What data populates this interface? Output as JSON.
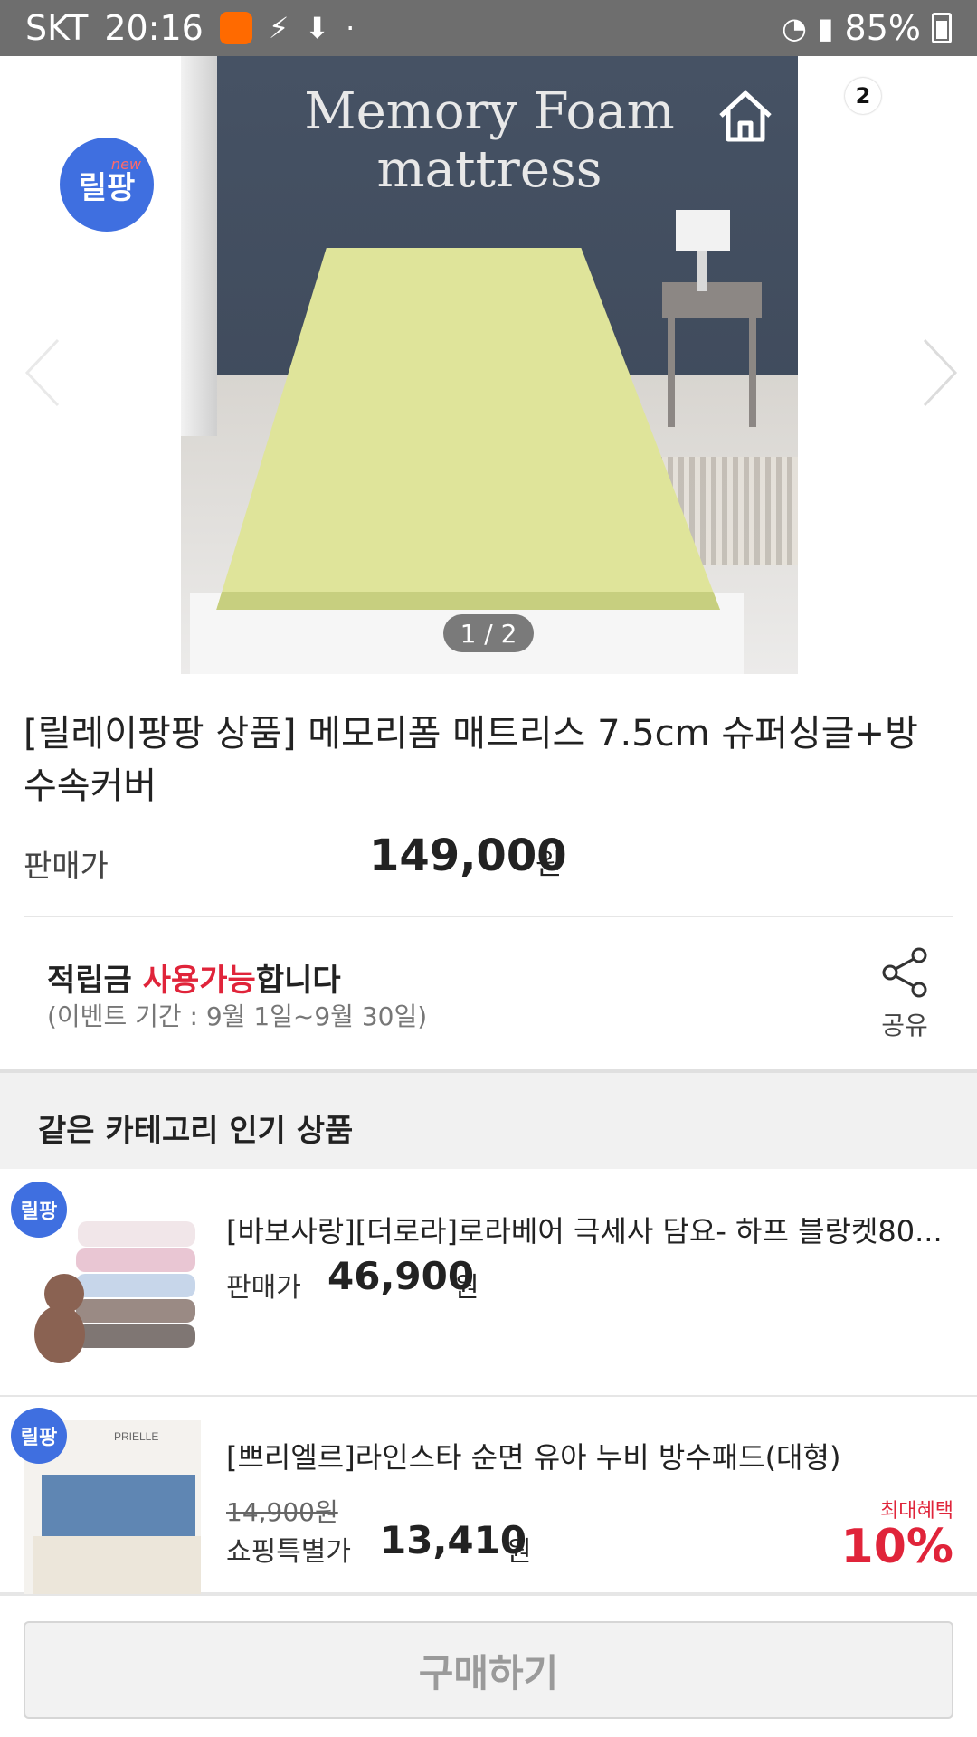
{
  "status_bar": {
    "carrier": "SKT",
    "time": "20:16",
    "battery": "85%"
  },
  "hero": {
    "title_line1": "Memory Foam",
    "title_line2": "mattress",
    "page_indicator": "1 / 2"
  },
  "header": {
    "brand_badge": "릴팡",
    "brand_badge_sup": "new",
    "cart_count": "2"
  },
  "product": {
    "title": "[릴레이팡팡 상품] 메모리폼 매트리스 7.5cm 슈퍼싱글+방수속커버",
    "price_label": "판매가",
    "price": "149,000",
    "price_unit": "원"
  },
  "points": {
    "prefix": "적립금 ",
    "highlight": "사용가능",
    "suffix": "합니다",
    "event_period": "(이벤트 기간 : 9월 1일~9월 30일)",
    "share_label": "공유"
  },
  "recommendations": {
    "section_title": "같은 카테고리 인기 상품",
    "items": [
      {
        "badge": "릴팡",
        "name": "[바보사랑][더로라]로라베어 극세사 담요- 하프 블랑켓80...",
        "price_label": "판매가",
        "price": "46,900",
        "unit": "원"
      },
      {
        "badge": "릴팡",
        "name": "[쁘리엘르]라인스타 순면 유아 누비 방수패드(대형)",
        "original_price": "14,900원",
        "price_label": "쇼핑특별가",
        "price": "13,410",
        "unit": "원",
        "benefit_label": "최대혜택",
        "benefit_percent": "10%"
      }
    ]
  },
  "bottom": {
    "buy_label": "구매하기"
  }
}
